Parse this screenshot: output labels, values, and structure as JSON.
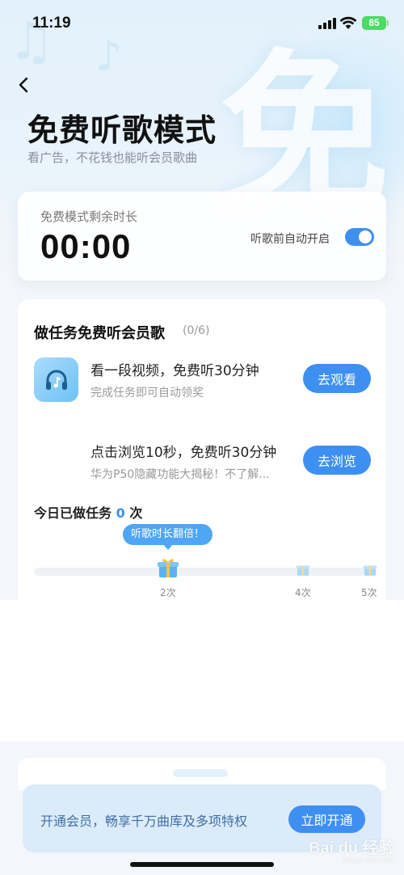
{
  "status_bar": {
    "time": "11:19",
    "battery": "85"
  },
  "header": {
    "title": "免费听歌模式",
    "subtitle": "看广告，不花钱也能听会员歌曲",
    "deco_char": "免"
  },
  "timer_card": {
    "label": "免费模式剩余时长",
    "value": "00:00",
    "auto_label": "听歌前自动开启",
    "auto_enabled": true
  },
  "tasks": {
    "title": "做任务免费听会员歌",
    "count": "(0/6)",
    "items": [
      {
        "name": "看一段视频，免费听30分钟",
        "desc": "完成任务即可自动领奖",
        "button": "去观看",
        "icon": "headphones-icon"
      },
      {
        "name": "点击浏览10秒，免费听30分钟",
        "desc": "华为P50隐藏功能大揭秘！不了解...",
        "button": "去浏览",
        "icon": "none"
      }
    ],
    "today_prefix": "今日已做任务",
    "today_count": "0",
    "today_suffix": "次",
    "tip": "听歌时长翻倍！",
    "steps": [
      "2次",
      "4次",
      "5次"
    ]
  },
  "vip_banner": {
    "text": "开通会员，畅享千万曲库及多项特权",
    "button": "立即开通"
  },
  "watermark": {
    "text": "Bai du 经验",
    "sub": "jingyan.baidu.com"
  },
  "colors": {
    "accent": "#3e8ff2",
    "tip": "#4ea6f5",
    "banner": "#dcebf9"
  }
}
